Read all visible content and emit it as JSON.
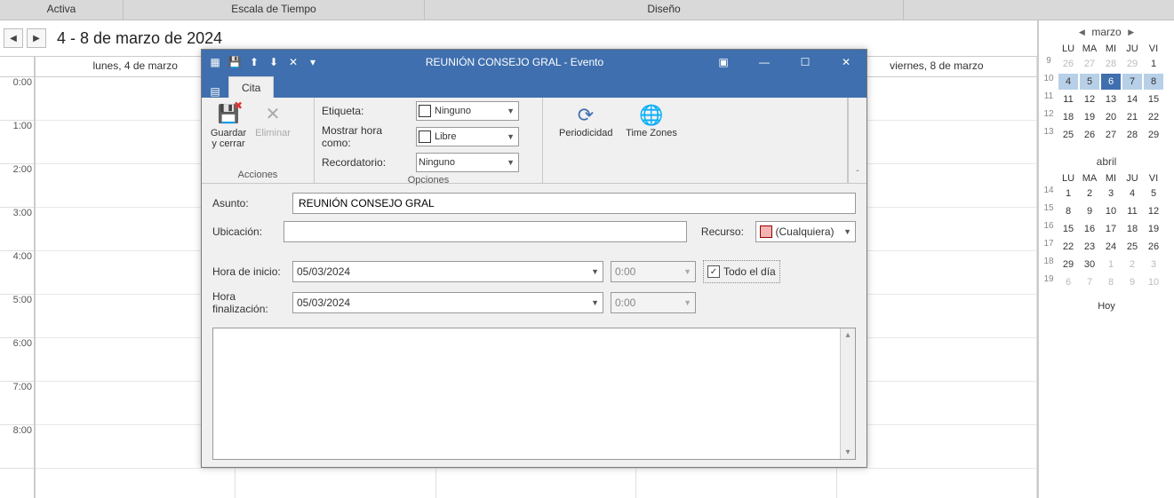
{
  "ribbon": {
    "tabs": [
      "Activa",
      "Escala de Tiempo",
      "Diseño"
    ]
  },
  "calendar": {
    "range_title": "4 - 8 de marzo de 2024",
    "days": [
      "lunes, 4 de marzo",
      "",
      "",
      "",
      "viernes, 8 de marzo"
    ],
    "times": [
      "0:00",
      "1:00",
      "2:00",
      "3:00",
      "4:00",
      "5:00",
      "6:00",
      "7:00",
      "8:00"
    ]
  },
  "miniCal": {
    "march": {
      "title": "marzo",
      "headers": [
        "LU",
        "MA",
        "MI",
        "JU",
        "VI"
      ],
      "weeks": [
        {
          "n": "9",
          "d": [
            {
              "v": "26",
              "dim": true
            },
            {
              "v": "27",
              "dim": true
            },
            {
              "v": "28",
              "dim": true
            },
            {
              "v": "29",
              "dim": true
            },
            {
              "v": "1"
            }
          ]
        },
        {
          "n": "10",
          "d": [
            {
              "v": "4",
              "sel": true
            },
            {
              "v": "5",
              "sel": true
            },
            {
              "v": "6",
              "sel": true,
              "today": true
            },
            {
              "v": "7",
              "sel": true
            },
            {
              "v": "8",
              "sel": true
            }
          ]
        },
        {
          "n": "11",
          "d": [
            {
              "v": "11"
            },
            {
              "v": "12"
            },
            {
              "v": "13"
            },
            {
              "v": "14"
            },
            {
              "v": "15"
            }
          ]
        },
        {
          "n": "12",
          "d": [
            {
              "v": "18"
            },
            {
              "v": "19"
            },
            {
              "v": "20"
            },
            {
              "v": "21"
            },
            {
              "v": "22"
            }
          ]
        },
        {
          "n": "13",
          "d": [
            {
              "v": "25"
            },
            {
              "v": "26"
            },
            {
              "v": "27"
            },
            {
              "v": "28"
            },
            {
              "v": "29"
            }
          ]
        }
      ]
    },
    "april": {
      "title": "abril",
      "headers": [
        "LU",
        "MA",
        "MI",
        "JU",
        "VI"
      ],
      "weeks": [
        {
          "n": "14",
          "d": [
            {
              "v": "1"
            },
            {
              "v": "2"
            },
            {
              "v": "3"
            },
            {
              "v": "4"
            },
            {
              "v": "5"
            }
          ]
        },
        {
          "n": "15",
          "d": [
            {
              "v": "8"
            },
            {
              "v": "9"
            },
            {
              "v": "10"
            },
            {
              "v": "11"
            },
            {
              "v": "12"
            }
          ]
        },
        {
          "n": "16",
          "d": [
            {
              "v": "15"
            },
            {
              "v": "16"
            },
            {
              "v": "17"
            },
            {
              "v": "18"
            },
            {
              "v": "19"
            }
          ]
        },
        {
          "n": "17",
          "d": [
            {
              "v": "22"
            },
            {
              "v": "23"
            },
            {
              "v": "24"
            },
            {
              "v": "25"
            },
            {
              "v": "26"
            }
          ]
        },
        {
          "n": "18",
          "d": [
            {
              "v": "29"
            },
            {
              "v": "30"
            },
            {
              "v": "1",
              "dim": true
            },
            {
              "v": "2",
              "dim": true
            },
            {
              "v": "3",
              "dim": true
            }
          ]
        },
        {
          "n": "19",
          "d": [
            {
              "v": "6",
              "dim": true
            },
            {
              "v": "7",
              "dim": true
            },
            {
              "v": "8",
              "dim": true
            },
            {
              "v": "9",
              "dim": true
            },
            {
              "v": "10",
              "dim": true
            }
          ]
        }
      ]
    },
    "today_label": "Hoy"
  },
  "dialog": {
    "title": "REUNIÓN CONSEJO GRAL - Evento",
    "tab": "Cita",
    "actions": {
      "save": "Guardar y cerrar",
      "delete": "Eliminar",
      "group": "Acciones"
    },
    "options": {
      "etiqueta_label": "Etiqueta:",
      "etiqueta_value": "Ninguno",
      "mostrar_label": "Mostrar hora como:",
      "mostrar_value": "Libre",
      "record_label": "Recordatorio:",
      "record_value": "Ninguno",
      "periodicidad": "Periodicidad",
      "timezones": "Time Zones",
      "group": "Opciones"
    },
    "form": {
      "asunto_label": "Asunto:",
      "asunto_value": "REUNIÓN CONSEJO GRAL",
      "ubic_label": "Ubicación:",
      "ubic_value": "",
      "recurso_label": "Recurso:",
      "recurso_value": "(Cualquiera)",
      "inicio_label": "Hora de inicio:",
      "inicio_date": "05/03/2024",
      "inicio_time": "0:00",
      "fin_label": "Hora finalización:",
      "fin_date": "05/03/2024",
      "fin_time": "0:00",
      "allday_label": "Todo el día",
      "allday_checked": "✓"
    }
  }
}
